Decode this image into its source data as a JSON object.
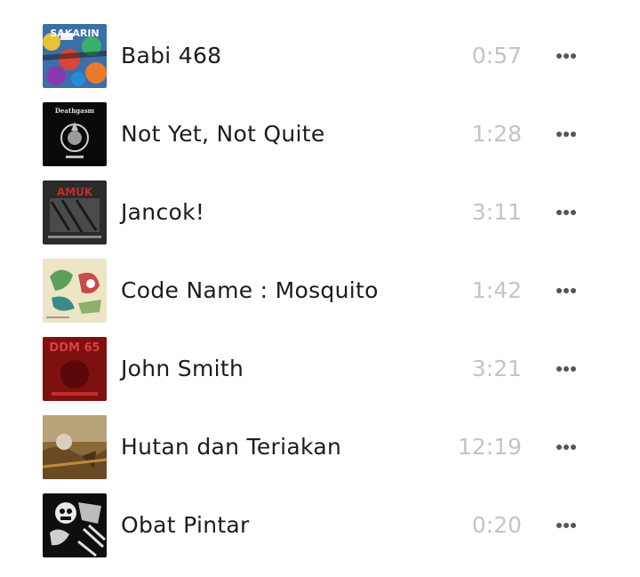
{
  "colors": {
    "title_text": "#1c1c1c",
    "duration_text": "#c4c4c4",
    "more_icon": "#555555",
    "background": "#ffffff"
  },
  "tracks": [
    {
      "title": "Babi 468",
      "duration": "0:57",
      "cover_text": "SAKARIN",
      "cover_icon": "colorful-graffiti-cover"
    },
    {
      "title": "Not Yet, Not Quite",
      "duration": "1:28",
      "cover_text": "Deathgasm",
      "cover_icon": "black-skull-emblem-cover"
    },
    {
      "title": "Jancok!",
      "duration": "3:11",
      "cover_text": "AMUK",
      "cover_icon": "dark-grunge-cover"
    },
    {
      "title": "Code Name : Mosquito",
      "duration": "1:42",
      "cover_text": "",
      "cover_icon": "cream-illustration-cover"
    },
    {
      "title": "John Smith",
      "duration": "3:21",
      "cover_text": "DDM 65",
      "cover_icon": "red-cover"
    },
    {
      "title": "Hutan dan Teriakan",
      "duration": "12:19",
      "cover_text": "",
      "cover_icon": "forest-photo-cover"
    },
    {
      "title": "Obat Pintar",
      "duration": "0:20",
      "cover_text": "",
      "cover_icon": "black-white-illustration-cover"
    }
  ]
}
